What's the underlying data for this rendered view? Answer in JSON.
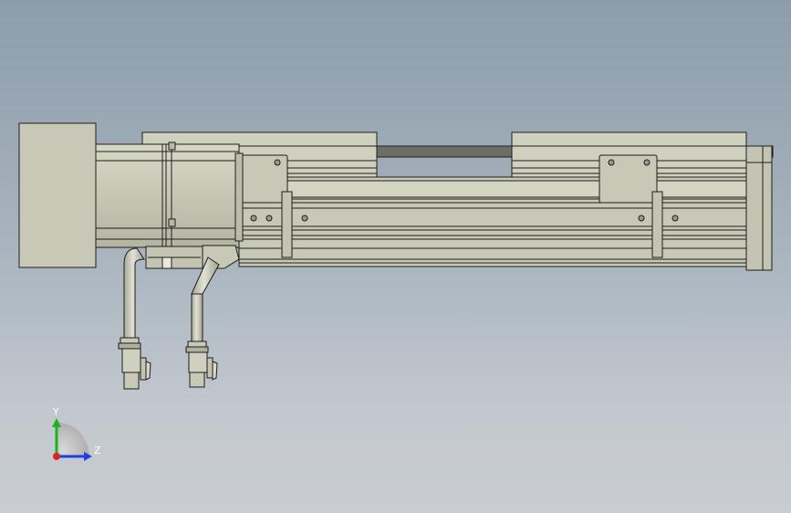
{
  "viewport": {
    "background_top": "#8d9dab",
    "background_bottom": "#c9cdd1"
  },
  "model": {
    "body_fill": "#c8c8b6",
    "body_fill_light": "#d6d6c4",
    "body_fill_dark": "#b8b8a6",
    "edge_color": "#1e1e1e",
    "hole_fill": "#9a9a8c"
  },
  "triad": {
    "y_label": "Y",
    "z_label": "Z",
    "y_color": "#1db31d",
    "z_color": "#1f3fe0",
    "x_color": "#e01f1f"
  }
}
